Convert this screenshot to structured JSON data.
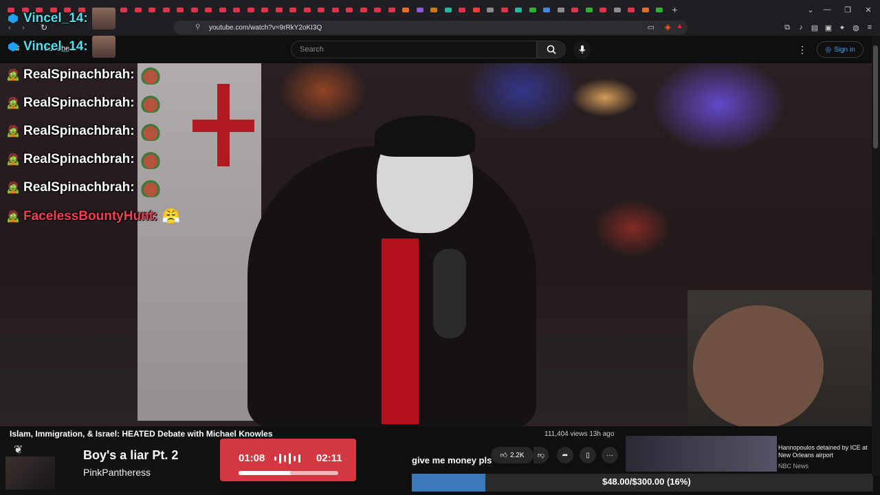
{
  "browser": {
    "url": "youtube.com/watch?v=9rRkY2oKI3Q",
    "tab_favicon_colors": [
      "#e0344a",
      "#e0344a",
      "#e0344a",
      "#e0344a",
      "#e0344a",
      "#e0344a",
      "#e0344a",
      "#e0344a",
      "#e0344a",
      "#e0344a",
      "#e0344a",
      "#e0344a",
      "#e0344a",
      "#e0344a",
      "#e0344a",
      "#e0344a",
      "#e0344a",
      "#e0344a",
      "#e0344a",
      "#e0344a",
      "#e0344a",
      "#e0344a",
      "#e0344a",
      "#e0344a",
      "#e0344a",
      "#e0344a",
      "#e0344a",
      "#e0344a",
      "#e76c28",
      "#8c57d8",
      "#cc7a16",
      "#2bb5a5",
      "#e0344a",
      "#ff3b3b",
      "#8c8c8c",
      "#e0344a",
      "#2bb5a5",
      "#30b030",
      "#3f8ae0",
      "#8c8c8c",
      "#e0344a",
      "#30b030",
      "#e0344a",
      "#8c8c8c",
      "#e0344a",
      "#e76c28",
      "#30b030"
    ],
    "new_tab_label": "+",
    "window_controls": [
      "chevron-down-icon",
      "minimize-icon",
      "restore-icon",
      "close-icon"
    ]
  },
  "youtube": {
    "search_placeholder": "Search",
    "sign_in_label": "Sign in",
    "logo_text": "YouTube"
  },
  "chat": [
    {
      "name": "Vincel_14:",
      "color": "#47e6f2",
      "emote": "photo"
    },
    {
      "name": "Vincel_14:",
      "color": "#47e6f2",
      "emote": "photo"
    },
    {
      "name": "RealSpinachbrah:",
      "color": "#ffffff",
      "emote": "tomato"
    },
    {
      "name": "RealSpinachbrah:",
      "color": "#ffffff",
      "emote": "tomato"
    },
    {
      "name": "RealSpinachbrah:",
      "color": "#ffffff",
      "emote": "tomato"
    },
    {
      "name": "RealSpinachbrah:",
      "color": "#ffffff",
      "emote": "tomato"
    },
    {
      "name": "RealSpinachbrah:",
      "color": "#ffffff",
      "emote": "tomato"
    },
    {
      "name": "FacelessBountyHunt:",
      "color": "#ff3b55",
      "emote": "😤"
    }
  ],
  "video": {
    "title": "Islam, Immigration, & Israel: HEATED Debate with Michael Knowles",
    "views": "111,404 views",
    "age": "13h ago",
    "likes": "2.2K"
  },
  "music_widget": {
    "song_title": "Boy's a liar Pt. 2",
    "artist": "PinkPantheress",
    "elapsed": "01:08",
    "total": "02:11",
    "progress_fraction": 0.52,
    "accent_color": "#d23742"
  },
  "donation": {
    "message": "give me money pls",
    "goal_text": "$48.00/$300.00 (16%)",
    "goal_fraction": 0.16,
    "bar_color": "#3a78b8"
  },
  "news": {
    "headline": "Hannopoulos detained by ICE at New Orleans airport",
    "source": "NBC News"
  }
}
